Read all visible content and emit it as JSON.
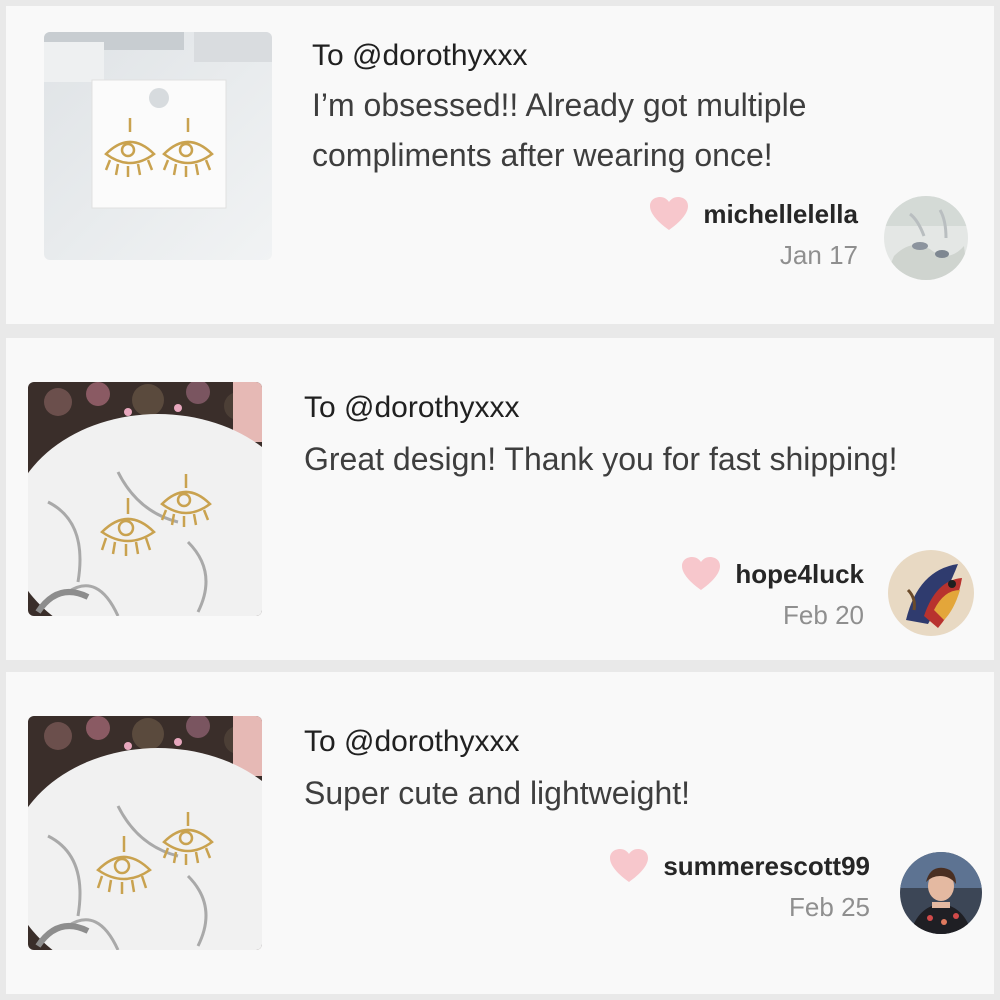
{
  "reviews": [
    {
      "recipient": "To @dorothyxxx",
      "text": "I’m obsessed!! Already got multiple compliments after wearing once!",
      "username": "michellelella",
      "date": "Jan 17"
    },
    {
      "recipient": "To @dorothyxxx",
      "text": "Great design! Thank you for fast shipping!",
      "username": "hope4luck",
      "date": "Feb 20"
    },
    {
      "recipient": "To @dorothyxxx",
      "text": "Super cute and lightweight!",
      "username": "summerescott99",
      "date": "Feb 25"
    }
  ],
  "icons": {
    "like": "heart-icon"
  },
  "colors": {
    "heart": "#f7c7cc",
    "card_background": "#f9f9f9",
    "page_background": "#e9e9e9",
    "earring_gold": "#c9a24f"
  }
}
